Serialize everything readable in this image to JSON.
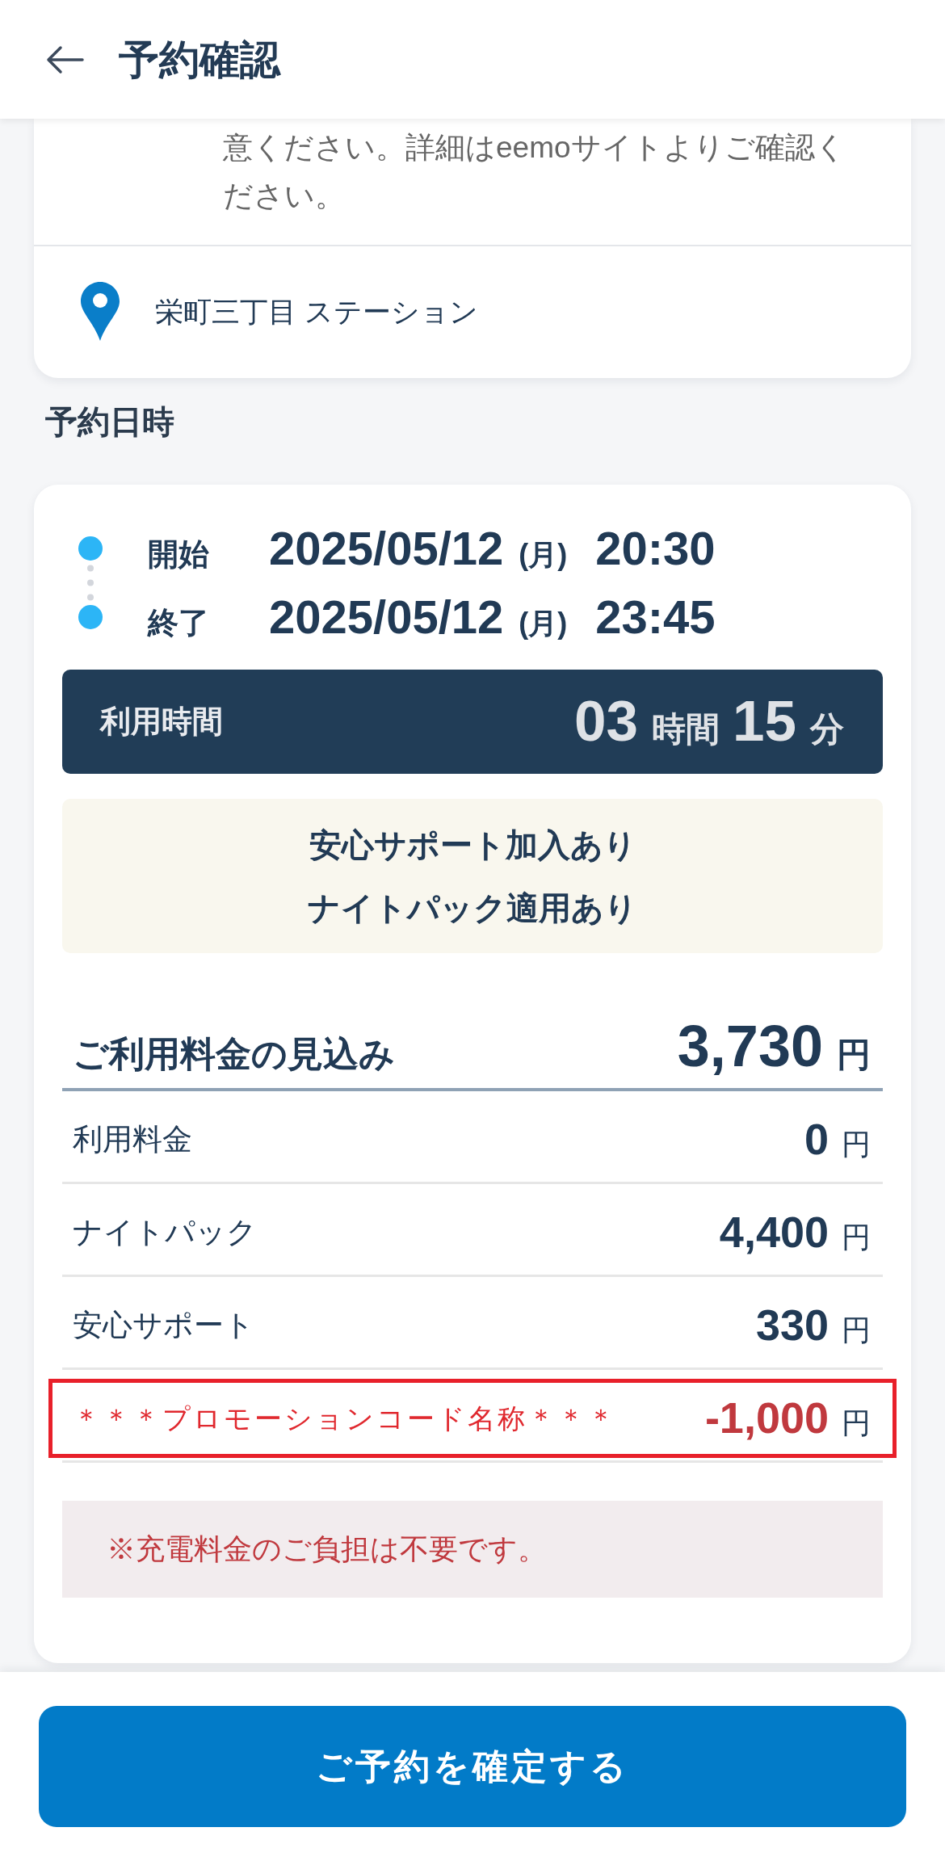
{
  "header": {
    "title": "予約確認"
  },
  "station_card": {
    "note": "意ください。詳細はeemoサイトよりご確認ください。",
    "station": "栄町三丁目 ステーション"
  },
  "schedule": {
    "heading": "予約日時",
    "times": [
      {
        "label": "開始",
        "date": "2025/05/12",
        "weekday": "(月)",
        "time": "20:30"
      },
      {
        "label": "終了",
        "date": "2025/05/12",
        "weekday": "(月)",
        "time": "23:45"
      }
    ],
    "duration": {
      "label": "利用時間",
      "hours": "03",
      "hours_unit": "時間",
      "minutes": "15",
      "minutes_unit": "分"
    },
    "options": [
      "安心サポート加入あり",
      "ナイトパック適用あり"
    ],
    "estimate": {
      "label": "ご利用料金の見込み",
      "amount": "3,730",
      "unit": "円"
    },
    "fees": [
      {
        "kind": "normal",
        "label": "利用料金",
        "amount": "0",
        "unit": "円",
        "highlighted": false
      },
      {
        "kind": "normal",
        "label": "ナイトパック",
        "amount": "4,400",
        "unit": "円",
        "highlighted": false
      },
      {
        "kind": "normal",
        "label": "安心サポート",
        "amount": "330",
        "unit": "円",
        "highlighted": false
      },
      {
        "kind": "discount",
        "label": "＊＊＊プロモーションコード名称＊＊＊",
        "amount": "-1,000",
        "unit": "円",
        "highlighted": true
      }
    ],
    "notice": "※充電料金のご負担は不要です。"
  },
  "confirm_button": {
    "label": "ご予約を確定する"
  }
}
